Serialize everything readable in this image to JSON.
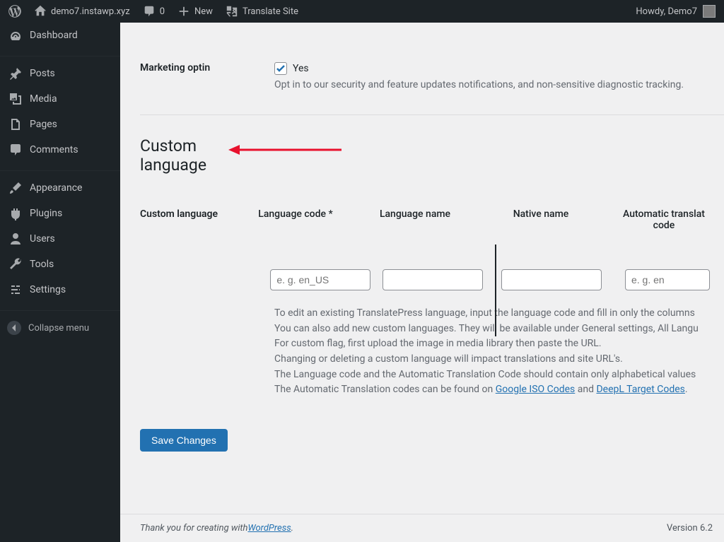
{
  "adminbar": {
    "site_name": "demo7.instawp.xyz",
    "comments_count": "0",
    "new_label": "New",
    "translate_label": "Translate Site",
    "howdy": "Howdy, Demo7"
  },
  "sidemenu": {
    "items": [
      {
        "label": "Dashboard"
      },
      {
        "label": "Posts"
      },
      {
        "label": "Media"
      },
      {
        "label": "Pages"
      },
      {
        "label": "Comments"
      },
      {
        "label": "Appearance"
      },
      {
        "label": "Plugins"
      },
      {
        "label": "Users"
      },
      {
        "label": "Tools"
      },
      {
        "label": "Settings"
      }
    ],
    "collapse": "Collapse menu"
  },
  "marketing": {
    "label": "Marketing optin",
    "yes": "Yes",
    "desc": "Opt in to our security and feature updates notifications, and non-sensitive diagnostic tracking."
  },
  "section": {
    "title_line1": "Custom",
    "title_line2": "language"
  },
  "table": {
    "row_label": "Custom language",
    "cols": {
      "code": "Language code *",
      "name": "Language name",
      "native": "Native name",
      "auto": "Automatic translation code"
    },
    "placeholders": {
      "code": "e. g. en_US",
      "auto": "e. g. en"
    }
  },
  "help": {
    "l1": "To edit an existing TranslatePress language, input the language code and fill in only the columns",
    "l2": "You can also add new custom languages. They will be available under General settings, All Langu",
    "l3": "For custom flag, first upload the image in media library then paste the URL.",
    "l4": "Changing or deleting a custom language will impact translations and site URL's.",
    "l5": "The Language code and the Automatic Translation Code should contain only alphabetical values",
    "l6a": "The Automatic Translation codes can be found on ",
    "link1": "Google ISO Codes",
    "l6b": " and ",
    "link2": "DeepL Target Codes",
    "l6c": "."
  },
  "save_label": "Save Changes",
  "footer": {
    "thanks_a": "Thank you for creating with ",
    "thanks_link": "WordPress",
    "thanks_b": ".",
    "version": "Version 6.2"
  }
}
